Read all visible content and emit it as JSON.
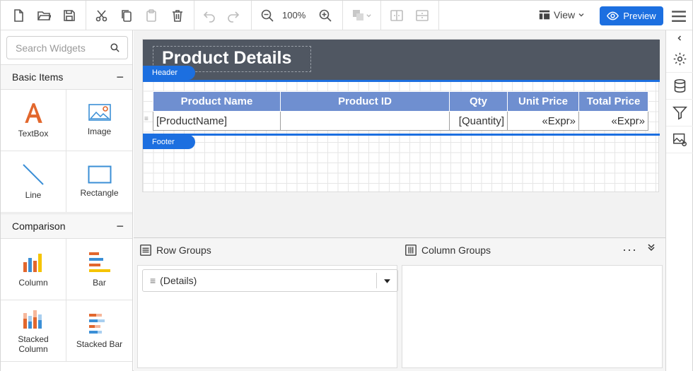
{
  "toolbar": {
    "zoom": "100%",
    "view_label": "View",
    "preview_label": "Preview"
  },
  "left_panel": {
    "search_placeholder": "Search Widgets",
    "categories": [
      {
        "label": "Basic Items",
        "items": [
          "TextBox",
          "Image",
          "Line",
          "Rectangle"
        ]
      },
      {
        "label": "Comparison",
        "items": [
          "Column",
          "Bar",
          "Stacked Column",
          "Stacked Bar"
        ]
      }
    ]
  },
  "report": {
    "title": "Product Details",
    "header_tag": "Header",
    "footer_tag": "Footer",
    "columns": [
      "Product Name",
      "Product ID",
      "Qty",
      "Unit Price",
      "Total Price"
    ],
    "row": [
      "[ProductName]",
      "",
      "[Quantity]",
      "«Expr»",
      "«Expr»"
    ]
  },
  "groups": {
    "row_groups_label": "Row Groups",
    "column_groups_label": "Column Groups",
    "row_group_item": "(Details)"
  },
  "colors": {
    "accent": "#1c6fe0",
    "header_band": "#505762",
    "table_header": "#6f8fd0"
  },
  "icons": [
    "new-file-icon",
    "open-folder-icon",
    "save-icon",
    "cut-icon",
    "copy-icon",
    "paste-icon",
    "delete-icon",
    "undo-icon",
    "redo-icon",
    "zoom-out-icon",
    "zoom-in-icon",
    "order-icon",
    "align-icon",
    "distribute-icon",
    "view-icon",
    "eye-icon",
    "hamburger-icon",
    "search-icon",
    "collapse-icon",
    "settings-icon",
    "data-icon",
    "filter-icon",
    "image-settings-icon"
  ]
}
